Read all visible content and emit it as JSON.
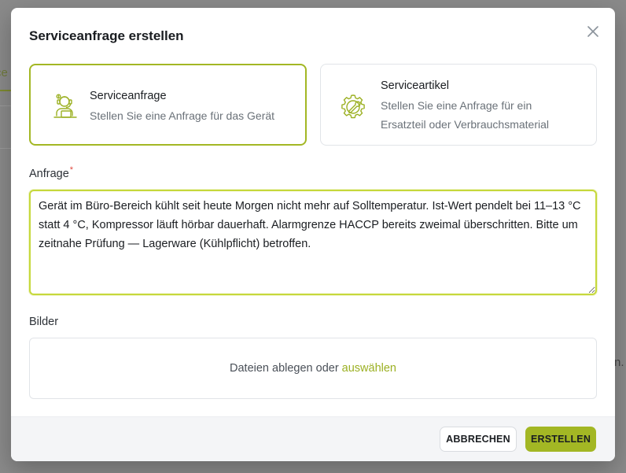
{
  "background": {
    "tab_fragment": "ce",
    "edge_fragment": "n."
  },
  "modal": {
    "title": "Serviceanfrage erstellen",
    "close_icon": "close-icon"
  },
  "cards": [
    {
      "title": "Serviceanfrage",
      "description": "Stellen Sie eine Anfrage für das Gerät",
      "icon": "support-agent-icon",
      "selected": true
    },
    {
      "title": "Serviceartikel",
      "description": "Stellen Sie eine Anfrage für ein Ersatzteil oder Verbrauchsmaterial",
      "icon": "gear-wrench-icon",
      "selected": false
    }
  ],
  "anfrage": {
    "label": "Anfrage",
    "required_marker": "*",
    "value": "Gerät im Büro-Bereich kühlt seit heute Morgen nicht mehr auf Solltemperatur. Ist-Wert pendelt bei 11–13 °C statt 4 °C, Kompressor läuft hörbar dauerhaft. Alarmgrenze HACCP bereits zweimal überschritten. Bitte um zeitnahe Prüfung — Lagerware (Kühlpflicht) betroffen."
  },
  "bilder": {
    "label": "Bilder",
    "drop_text": "Dateien ablegen oder",
    "select_link": "auswählen"
  },
  "footer": {
    "cancel_label": "ABBRECHEN",
    "create_label": "ERSTELLEN"
  },
  "colors": {
    "accent": "#a3b724",
    "link": "#9bb022",
    "required": "#e0483e",
    "overlay": "#7d7d7d"
  }
}
